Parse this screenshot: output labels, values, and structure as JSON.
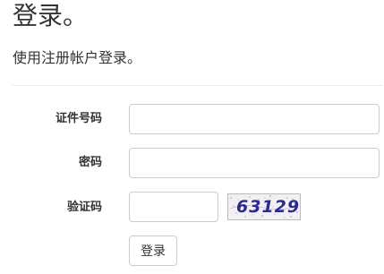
{
  "header": {
    "title": "登录。",
    "subtitle": "使用注册帐户登录。"
  },
  "form": {
    "id_label": "证件号码",
    "id_value": "",
    "password_label": "密码",
    "password_value": "",
    "captcha_label": "验证码",
    "captcha_value": "",
    "captcha_text": "63129",
    "submit_label": "登录"
  }
}
